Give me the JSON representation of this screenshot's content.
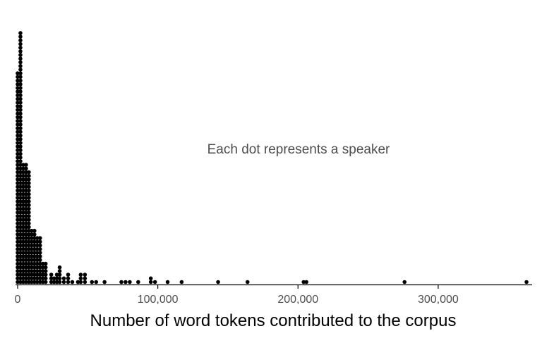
{
  "chart_data": {
    "type": "scatter",
    "subtype": "dot plot (stacked dots)",
    "title": "",
    "xlabel": "Number of word tokens contributed to the corpus",
    "ylabel": "",
    "annotation": "Each dot represents a speaker",
    "xlim": [
      -1500,
      367000
    ],
    "xticks": [
      0,
      100000,
      200000,
      300000
    ],
    "xtick_labels": [
      "0",
      "100,000",
      "200,000",
      "300,000"
    ],
    "grid": false,
    "legend": "none",
    "colors": {
      "dot": "#000000",
      "text": "#4d4d4d",
      "axis": "#000000"
    },
    "bins": [
      {
        "x": 0,
        "count": 58
      },
      {
        "x": 2000,
        "count": 69
      },
      {
        "x": 4000,
        "count": 33
      },
      {
        "x": 6000,
        "count": 33
      },
      {
        "x": 8000,
        "count": 31
      },
      {
        "x": 10000,
        "count": 15
      },
      {
        "x": 12000,
        "count": 15
      },
      {
        "x": 14000,
        "count": 13
      },
      {
        "x": 16000,
        "count": 13
      },
      {
        "x": 18000,
        "count": 6
      },
      {
        "x": 20000,
        "count": 6
      },
      {
        "x": 24000,
        "count": 3
      },
      {
        "x": 26000,
        "count": 2
      },
      {
        "x": 28000,
        "count": 3
      },
      {
        "x": 30000,
        "count": 5
      },
      {
        "x": 33000,
        "count": 2
      },
      {
        "x": 36000,
        "count": 3
      },
      {
        "x": 39000,
        "count": 1
      },
      {
        "x": 43000,
        "count": 1
      },
      {
        "x": 45000,
        "count": 3
      },
      {
        "x": 48000,
        "count": 3
      },
      {
        "x": 53000,
        "count": 1
      },
      {
        "x": 56000,
        "count": 1
      },
      {
        "x": 62000,
        "count": 1
      },
      {
        "x": 74000,
        "count": 1
      },
      {
        "x": 77000,
        "count": 1
      },
      {
        "x": 80000,
        "count": 1
      },
      {
        "x": 86000,
        "count": 1
      },
      {
        "x": 95000,
        "count": 2
      },
      {
        "x": 98000,
        "count": 1
      },
      {
        "x": 107000,
        "count": 1
      },
      {
        "x": 117000,
        "count": 1
      },
      {
        "x": 143000,
        "count": 1
      },
      {
        "x": 164000,
        "count": 1
      },
      {
        "x": 204000,
        "count": 1
      },
      {
        "x": 206000,
        "count": 1
      },
      {
        "x": 276000,
        "count": 1
      },
      {
        "x": 363000,
        "count": 1
      }
    ]
  }
}
